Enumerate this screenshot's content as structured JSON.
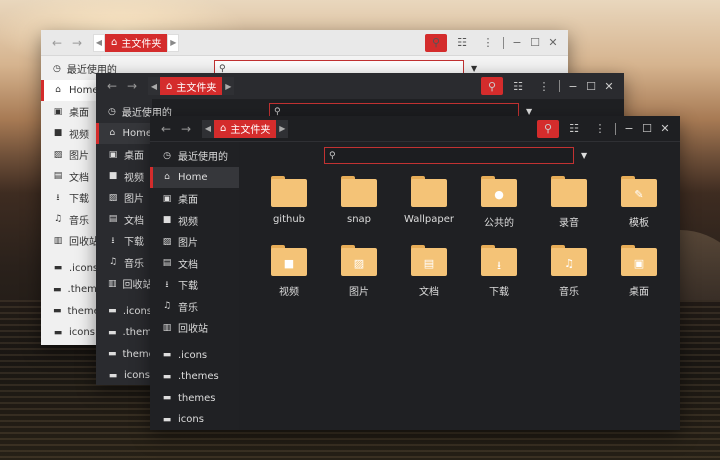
{
  "windows": [
    {
      "location": "主文件夹",
      "sidebar": [
        {
          "label": "最近使用的",
          "icon": "clock-icon"
        },
        {
          "label": "Home",
          "icon": "home-icon",
          "active": true
        },
        {
          "label": "桌面",
          "icon": "desktop-icon"
        },
        {
          "label": "视频",
          "icon": "video-icon"
        },
        {
          "label": "图片",
          "icon": "image-icon"
        },
        {
          "label": "文档",
          "icon": "document-icon"
        },
        {
          "label": "下载",
          "icon": "download-icon"
        },
        {
          "label": "音乐",
          "icon": "music-icon"
        },
        {
          "label": "回收站",
          "icon": "trash-icon"
        },
        {
          "label": ".icons",
          "icon": "folder-icon"
        },
        {
          "label": ".themes",
          "icon": "folder-icon"
        },
        {
          "label": "themes",
          "icon": "folder-icon"
        },
        {
          "label": "icons",
          "icon": "folder-icon"
        }
      ]
    },
    {
      "location": "主文件夹",
      "sidebar": [
        {
          "label": "最近使用的",
          "icon": "clock-icon"
        },
        {
          "label": "Home",
          "icon": "home-icon",
          "active": true
        },
        {
          "label": "桌面",
          "icon": "desktop-icon"
        },
        {
          "label": "视频",
          "icon": "video-icon"
        },
        {
          "label": "图片",
          "icon": "image-icon"
        },
        {
          "label": "文档",
          "icon": "document-icon"
        },
        {
          "label": "下载",
          "icon": "download-icon"
        },
        {
          "label": "音乐",
          "icon": "music-icon"
        },
        {
          "label": "回收站",
          "icon": "trash-icon"
        },
        {
          "label": ".icons",
          "icon": "folder-icon"
        },
        {
          "label": ".themes",
          "icon": "folder-icon"
        },
        {
          "label": "themes",
          "icon": "folder-icon"
        },
        {
          "label": "icons",
          "icon": "folder-icon"
        }
      ]
    },
    {
      "location": "主文件夹",
      "sidebar": [
        {
          "label": "最近使用的",
          "icon": "clock-icon"
        },
        {
          "label": "Home",
          "icon": "home-icon",
          "active": true
        },
        {
          "label": "桌面",
          "icon": "desktop-icon"
        },
        {
          "label": "视频",
          "icon": "video-icon"
        },
        {
          "label": "图片",
          "icon": "image-icon"
        },
        {
          "label": "文档",
          "icon": "document-icon"
        },
        {
          "label": "下载",
          "icon": "download-icon"
        },
        {
          "label": "音乐",
          "icon": "music-icon"
        },
        {
          "label": "回收站",
          "icon": "trash-icon"
        },
        {
          "label": ".icons",
          "icon": "folder-icon"
        },
        {
          "label": ".themes",
          "icon": "folder-icon"
        },
        {
          "label": "themes",
          "icon": "folder-icon"
        },
        {
          "label": "icons",
          "icon": "folder-icon"
        }
      ],
      "files": [
        {
          "name": "github",
          "emblem": ""
        },
        {
          "name": "snap",
          "emblem": ""
        },
        {
          "name": "Wallpaper",
          "emblem": ""
        },
        {
          "name": "公共的",
          "emblem": "person-icon"
        },
        {
          "name": "录音",
          "emblem": ""
        },
        {
          "name": "模板",
          "emblem": "template-icon"
        },
        {
          "name": "视频",
          "emblem": "video-icon"
        },
        {
          "name": "图片",
          "emblem": "image-icon"
        },
        {
          "name": "文档",
          "emblem": "document-icon"
        },
        {
          "name": "下载",
          "emblem": "download-icon"
        },
        {
          "name": "音乐",
          "emblem": "music-icon"
        },
        {
          "name": "桌面",
          "emblem": "desktop-icon"
        }
      ]
    }
  ],
  "colors": {
    "accent": "#d42c2c",
    "folder": "#f4c377",
    "dark_bg": "#1f2023"
  }
}
